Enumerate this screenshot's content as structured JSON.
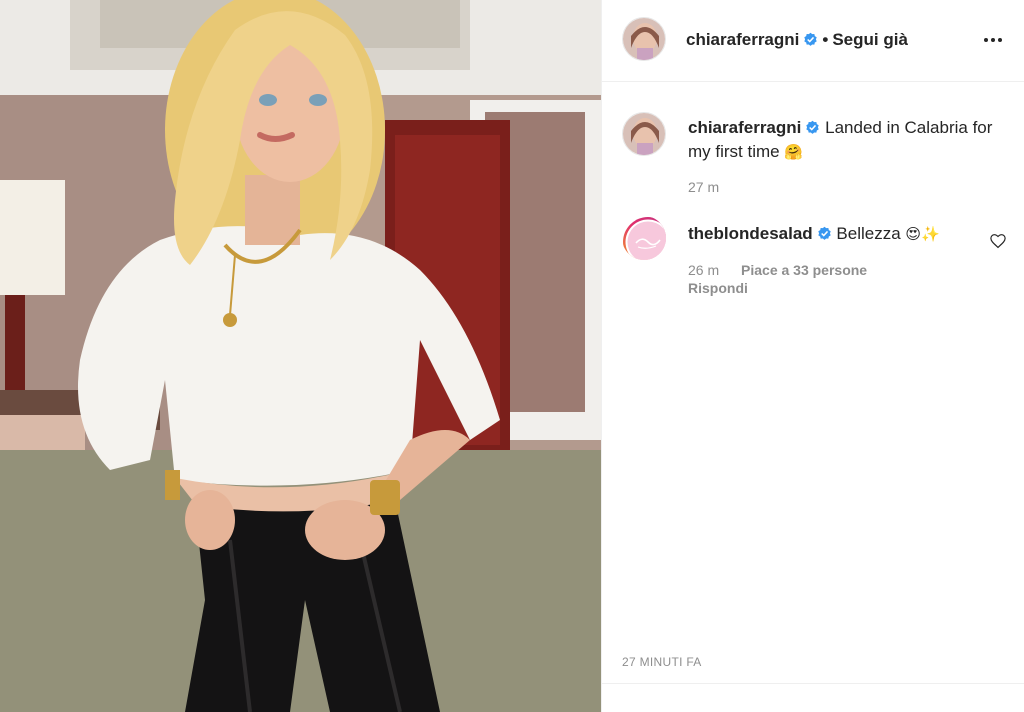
{
  "post": {
    "author": "chiaraferragni",
    "follow_status": "Segui già",
    "more_icon": "more-options-icon",
    "photo_alt": "Chiara Ferragni photo"
  },
  "caption": {
    "author": "chiaraferragni",
    "text": "Landed in Calabria for my first time",
    "emoji": "🤗",
    "time": "27 m"
  },
  "comments": [
    {
      "author": "theblondesalad",
      "text": "Bellezza",
      "emoji": "😍✨",
      "time": "26 m",
      "likes": "Piace a 33 persone",
      "reply_label": "Rispondi"
    }
  ],
  "footer": {
    "timestamp": "27 MINUTI FA"
  },
  "colors": {
    "verified": "#3897f0",
    "text": "#262626",
    "secondary": "#8e8e8e",
    "divider": "#efefef",
    "story_ring": "#e1306c"
  }
}
